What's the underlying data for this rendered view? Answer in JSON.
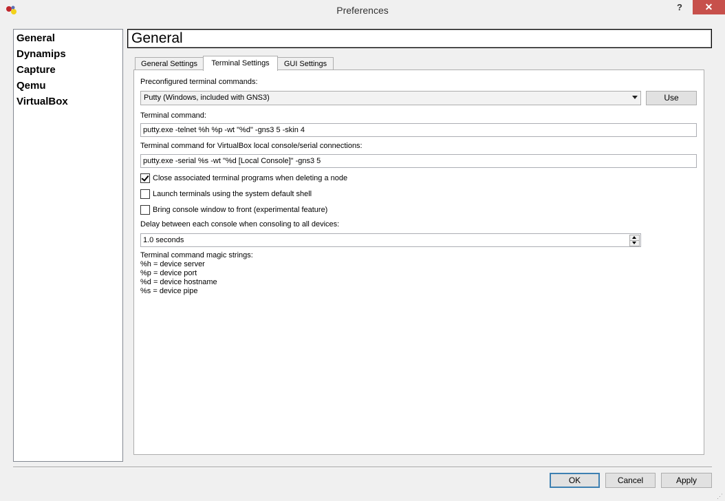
{
  "window": {
    "title": "Preferences",
    "help": "?",
    "close": "✕"
  },
  "sidebar": {
    "items": [
      {
        "label": "General"
      },
      {
        "label": "Dynamips"
      },
      {
        "label": "Capture"
      },
      {
        "label": "Qemu"
      },
      {
        "label": "VirtualBox"
      }
    ]
  },
  "page": {
    "title": "General"
  },
  "tabs": [
    {
      "label": "General Settings"
    },
    {
      "label": "Terminal Settings"
    },
    {
      "label": "GUI Settings"
    }
  ],
  "terminal": {
    "preconfigured_label": "Preconfigured terminal commands:",
    "preconfigured_value": "Putty (Windows, included with GNS3)",
    "use_button": "Use",
    "command_label": "Terminal command:",
    "command_value": "putty.exe -telnet %h %p -wt \"%d\" -gns3 5 -skin 4",
    "vbox_label": "Terminal command for VirtualBox local console/serial connections:",
    "vbox_value": "putty.exe -serial %s -wt \"%d [Local Console]\" -gns3 5",
    "checkboxes": [
      {
        "label": "Close associated terminal programs when deleting a node",
        "checked": true
      },
      {
        "label": "Launch terminals using the system default shell",
        "checked": false
      },
      {
        "label": "Bring console window to front (experimental feature)",
        "checked": false
      }
    ],
    "delay_label": "Delay between each console when consoling to all devices:",
    "delay_value": "1.0 seconds",
    "magic_title": "Terminal command magic strings:",
    "magic_lines": [
      "%h = device server",
      "%p = device port",
      "%d = device hostname",
      "%s = device pipe"
    ]
  },
  "buttons": {
    "ok": "OK",
    "cancel": "Cancel",
    "apply": "Apply"
  }
}
